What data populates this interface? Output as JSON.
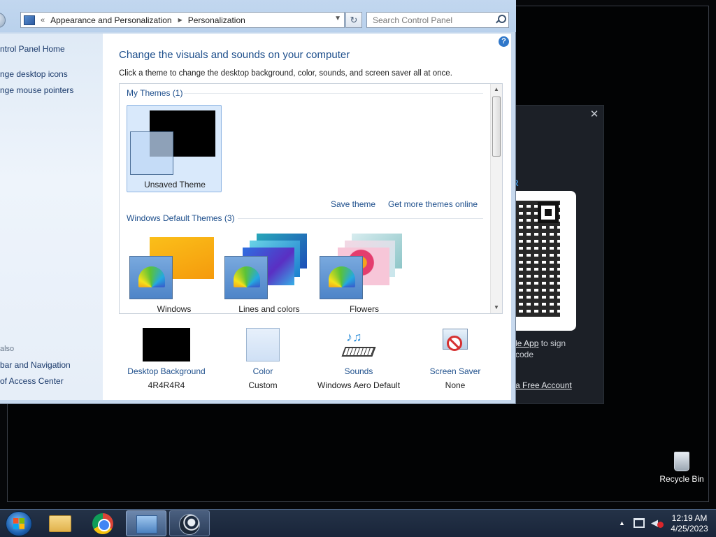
{
  "address_bar": {
    "overflow": "«",
    "segments": [
      "Appearance and Personalization",
      "Personalization"
    ],
    "search_placeholder": "Search Control Panel"
  },
  "sidebar": {
    "items": [
      "ntrol Panel Home",
      "nge desktop icons",
      "nge mouse pointers"
    ],
    "see_also_heading": "also",
    "see_also": [
      "bar and Navigation",
      "of Access Center"
    ]
  },
  "content": {
    "help": "?",
    "title": "Change the visuals and sounds on your computer",
    "subtitle": "Click a theme to change the desktop background, color, sounds, and screen saver all at once.",
    "my_themes": {
      "label": "My Themes (1)",
      "items": [
        {
          "name": "Unsaved Theme",
          "selected": true
        }
      ]
    },
    "actions": {
      "save": "Save theme",
      "more": "Get more themes online"
    },
    "default_themes": {
      "label": "Windows Default Themes (3)",
      "items": [
        {
          "name": "Windows"
        },
        {
          "name": "Lines and colors"
        },
        {
          "name": "Flowers"
        }
      ]
    },
    "bottom": [
      {
        "label": "Desktop Background",
        "value": "4R4R4R4"
      },
      {
        "label": "Color",
        "value": "Custom"
      },
      {
        "label": "Sounds",
        "value": "Windows Aero Default"
      },
      {
        "label": "Screen Saver",
        "value": "None"
      }
    ]
  },
  "steam_dialog": {
    "close": "✕",
    "heading_fragment": "R",
    "line1_link": "le App",
    "line1_rest": " to sign",
    "line2": "code",
    "footer_link": "a Free Account"
  },
  "desktop": {
    "recycle_bin": "Recycle Bin"
  },
  "taskbar": {
    "time": "12:19 AM",
    "date": "4/25/2023"
  },
  "colors": {
    "accent_link": "#1e4f8c",
    "selection": "#d9e9fb",
    "taskbar": "#1d2a3f"
  }
}
